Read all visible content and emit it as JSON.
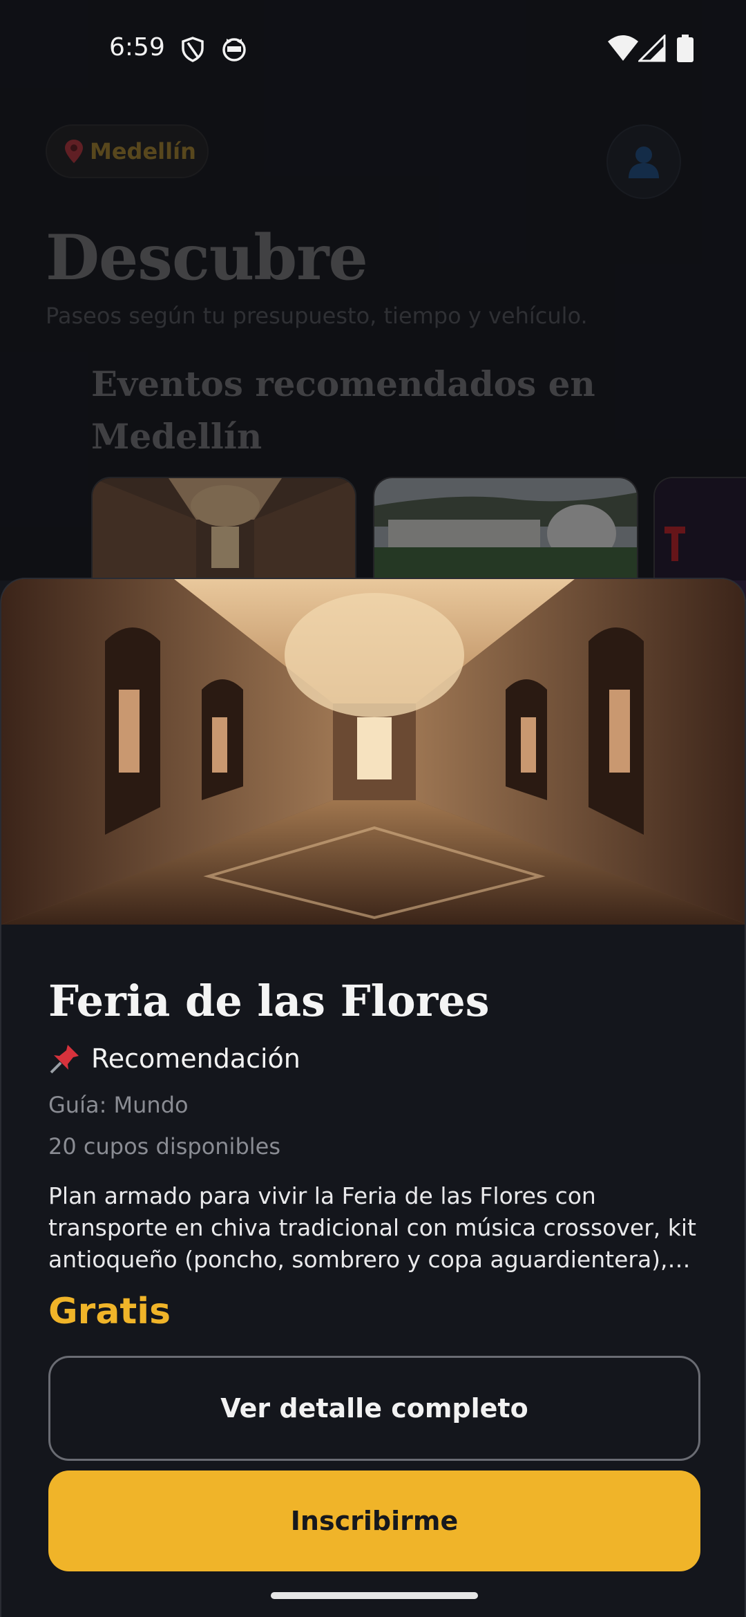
{
  "status_bar": {
    "time": "6:59",
    "icons": [
      "shield-icon",
      "cat-face-icon",
      "wifi-icon",
      "cell-signal-icon",
      "battery-icon"
    ]
  },
  "background_page": {
    "location_chip": {
      "icon": "map-pin-icon",
      "label": "Medellín"
    },
    "profile_icon": "user-icon",
    "title": "Descubre",
    "subtitle": "Paseos según tu presupuesto, tiempo y vehículo.",
    "section_title": "Eventos recomendados en Medellín",
    "cards": [
      {
        "image": "museum-gallery-image"
      },
      {
        "image": "planetarium-building-image"
      },
      {
        "image": "red-poster-image",
        "partial_text": "T"
      }
    ]
  },
  "sheet": {
    "hero_image": "museum-gallery-image",
    "title": "Feria de las Flores",
    "recommendation": {
      "icon": "pushpin-icon",
      "label": "Recomendación"
    },
    "guide": "Guía: Mundo",
    "spots": "20 cupos disponibles",
    "description": "Plan armado para vivir la Feria de las Flores con transporte en chiva tradicional con música crossover, kit antioqueño (poncho, sombrero y copa aguardientera), visita al Parqu...",
    "price": "Gratis",
    "detail_button": "Ver detalle completo",
    "signup_button": "Inscribirme"
  },
  "colors": {
    "accent": "#f0b429",
    "background": "#14161c",
    "muted_text": "#8a8c93"
  }
}
